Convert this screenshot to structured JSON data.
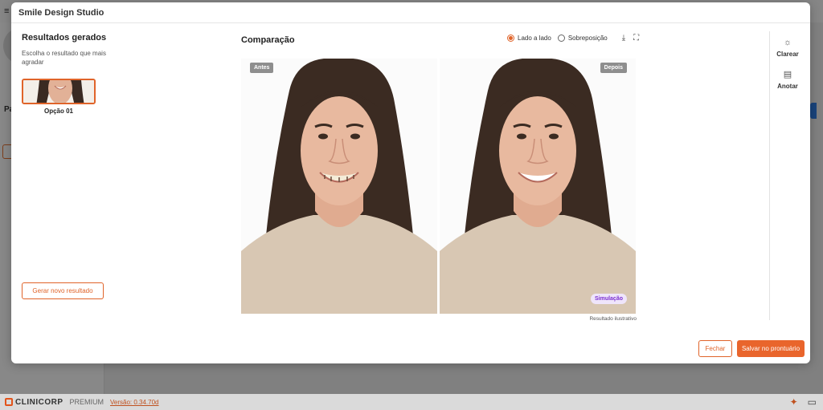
{
  "modal": {
    "title": "Smile Design Studio"
  },
  "left_panel": {
    "title": "Resultados gerados",
    "subtitle": "Escolha o resultado que mais agradar",
    "options": [
      {
        "label": "Opção 01"
      }
    ],
    "generate_label": "Gerar novo resultado"
  },
  "comparison": {
    "title": "Comparação",
    "view_modes": [
      {
        "label": "Lado a lado",
        "selected": true
      },
      {
        "label": "Sobreposição",
        "selected": false
      }
    ],
    "before_tag": "Antes",
    "after_tag": "Depois",
    "simulation_badge": "Simulação",
    "note": "Resultado ilustrativo"
  },
  "side_tools": [
    {
      "label": "Clarear",
      "icon": "sun-icon"
    },
    {
      "label": "Anotar",
      "icon": "note-icon"
    }
  ],
  "actions": {
    "close_label": "Fechar",
    "save_label": "Salvar no prontuário"
  },
  "background": {
    "panel_label": "Pa"
  },
  "footer": {
    "brand": "CLINICORP",
    "plan": "PREMIUM",
    "version": "Versão: 0.34.70d"
  },
  "colors": {
    "accent": "#e9652c",
    "simulation": "#7b2fcf",
    "tag_bg": "#8e8e8e"
  }
}
